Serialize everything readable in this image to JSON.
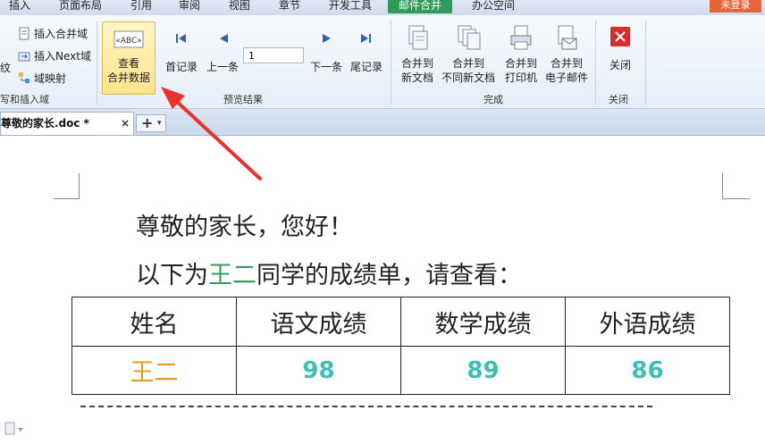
{
  "menu": {
    "tabs": [
      "插入",
      "页面布局",
      "引用",
      "审阅",
      "视图",
      "章节",
      "开发工具",
      "邮件合并",
      "办公空间"
    ],
    "active_tab": "邮件合并",
    "login_label": "未登录",
    "active_color": "#2f9b5a",
    "login_color": "#e8653a"
  },
  "ribbon": {
    "write_insert_group": {
      "partial_left_label": "纹",
      "insert_merge_field": "插入合并域",
      "insert_next_field": "插入Next域",
      "field_mapping": "域映射",
      "group_label": "写和插入域"
    },
    "view_merge_data": {
      "line1": "查看",
      "line2": "合并数据",
      "icon_text": "«ABC»"
    },
    "preview_group": {
      "first_record": "首记录",
      "prev": "上一条",
      "record_number": "1",
      "next": "下一条",
      "last_record": "尾记录",
      "group_label": "预览结果"
    },
    "finish_group": {
      "merge_new_doc": [
        "合并到",
        "新文档"
      ],
      "merge_diff_docs": [
        "合并到",
        "不同新文档"
      ],
      "merge_printer": [
        "合并到",
        "打印机"
      ],
      "merge_email": [
        "合并到",
        "电子邮件"
      ],
      "group_label": "完成"
    },
    "close_group": {
      "close": "关闭",
      "group_label": "关闭"
    }
  },
  "doc_tab": {
    "title": "尊敬的家长.doc *",
    "close_glyph": "×",
    "add_glyph": "+",
    "dropdown_glyph": "▾"
  },
  "document": {
    "greeting": "尊敬的家长，您好！",
    "line2_prefix": "以下为",
    "merge_name": "王二",
    "line2_suffix": "同学的成绩单，请查看：",
    "table": {
      "headers": [
        "姓名",
        "语文成绩",
        "数学成绩",
        "外语成绩"
      ],
      "row": [
        "王二",
        "98",
        "89",
        "86"
      ]
    },
    "colors": {
      "merge_field_green": "#3a9a5c",
      "name_orange": "#e79a1e",
      "score_teal": "#3cbfb5",
      "arrow_red": "#e8322a"
    }
  }
}
